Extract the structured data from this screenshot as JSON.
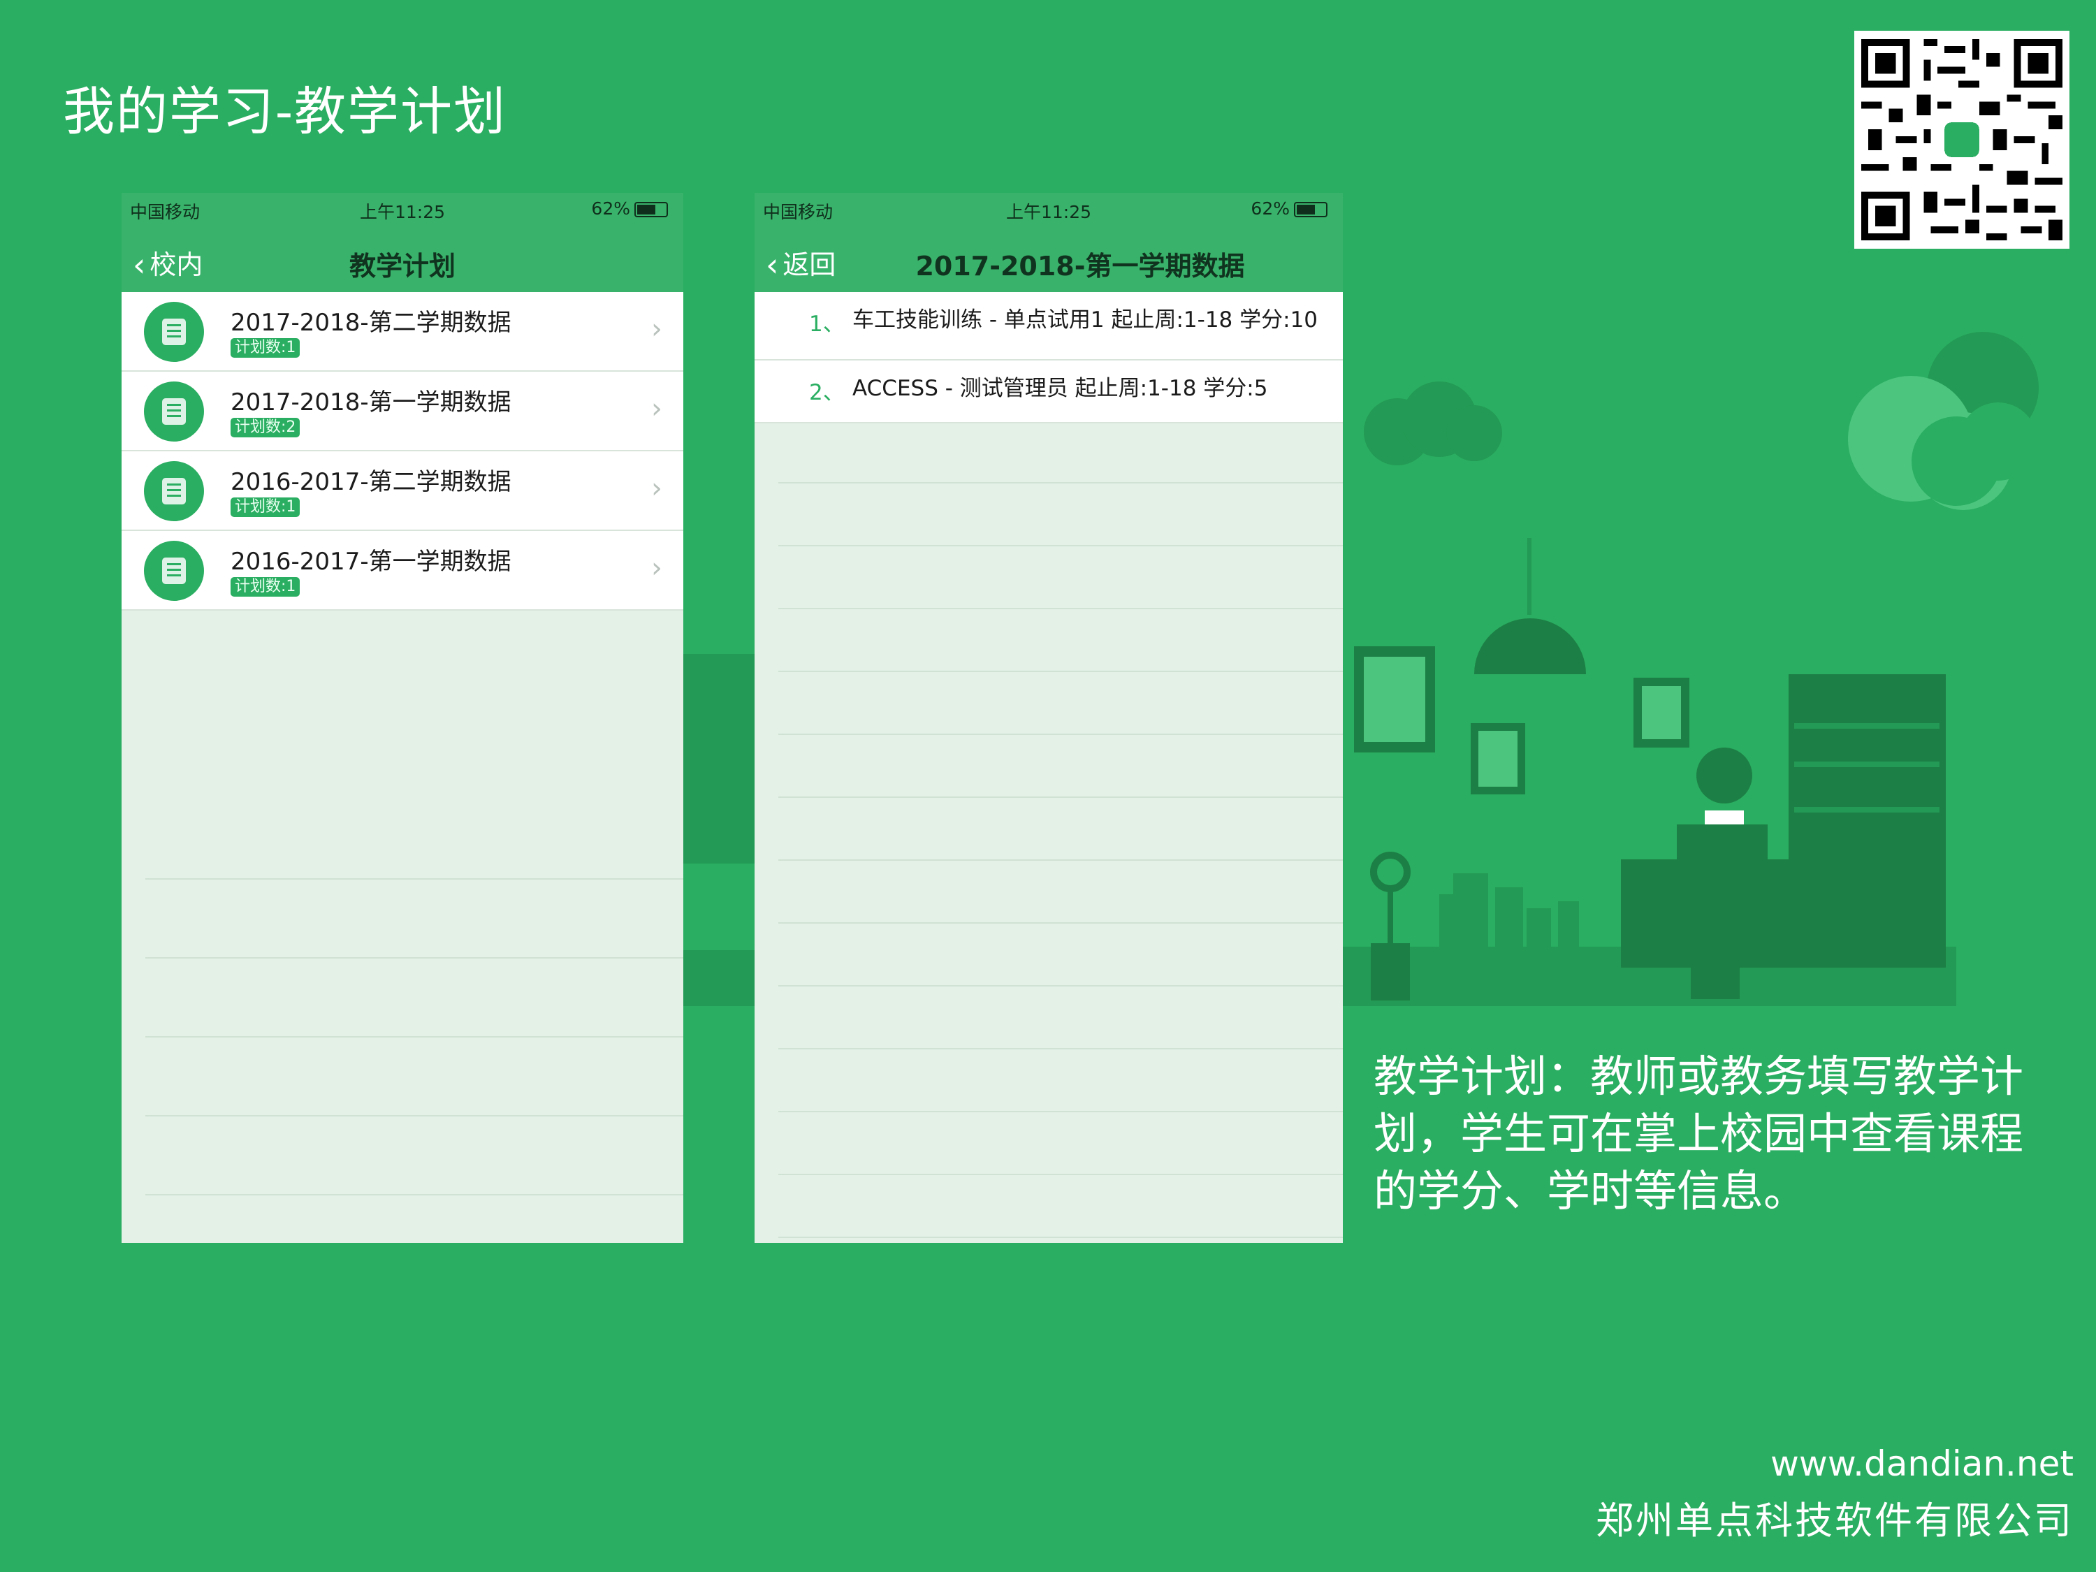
{
  "slide": {
    "title": "我的学习-教学计划",
    "description": "教学计划：教师或教务填写教学计划，学生可在掌上校园中查看课程的学分、学时等信息。",
    "website": "www.dandian.net",
    "company": "郑州单点科技软件有限公司"
  },
  "status_bar": {
    "carrier": "中国移动",
    "time": "上午11:25",
    "battery": "62%"
  },
  "phone1": {
    "back_label": "校内",
    "title": "教学计划",
    "plans": [
      {
        "name": "2017-2018-第二学期数据",
        "count": "计划数:1"
      },
      {
        "name": "2017-2018-第一学期数据",
        "count": "计划数:2"
      },
      {
        "name": "2016-2017-第二学期数据",
        "count": "计划数:1"
      },
      {
        "name": "2016-2017-第一学期数据",
        "count": "计划数:1"
      }
    ]
  },
  "phone2": {
    "back_label": "返回",
    "title": "2017-2018-第一学期数据",
    "courses": [
      {
        "index": "1、",
        "text": "车工技能训练 - 单点试用1  起止周:1-18 学分:10"
      },
      {
        "index": "2、",
        "text": "ACCESS - 测试管理员  起止周:1-18 学分:5"
      }
    ]
  },
  "colors": {
    "background": "#2aae61",
    "navbar": "#39b36b",
    "list_background": "#e3f1e6"
  }
}
